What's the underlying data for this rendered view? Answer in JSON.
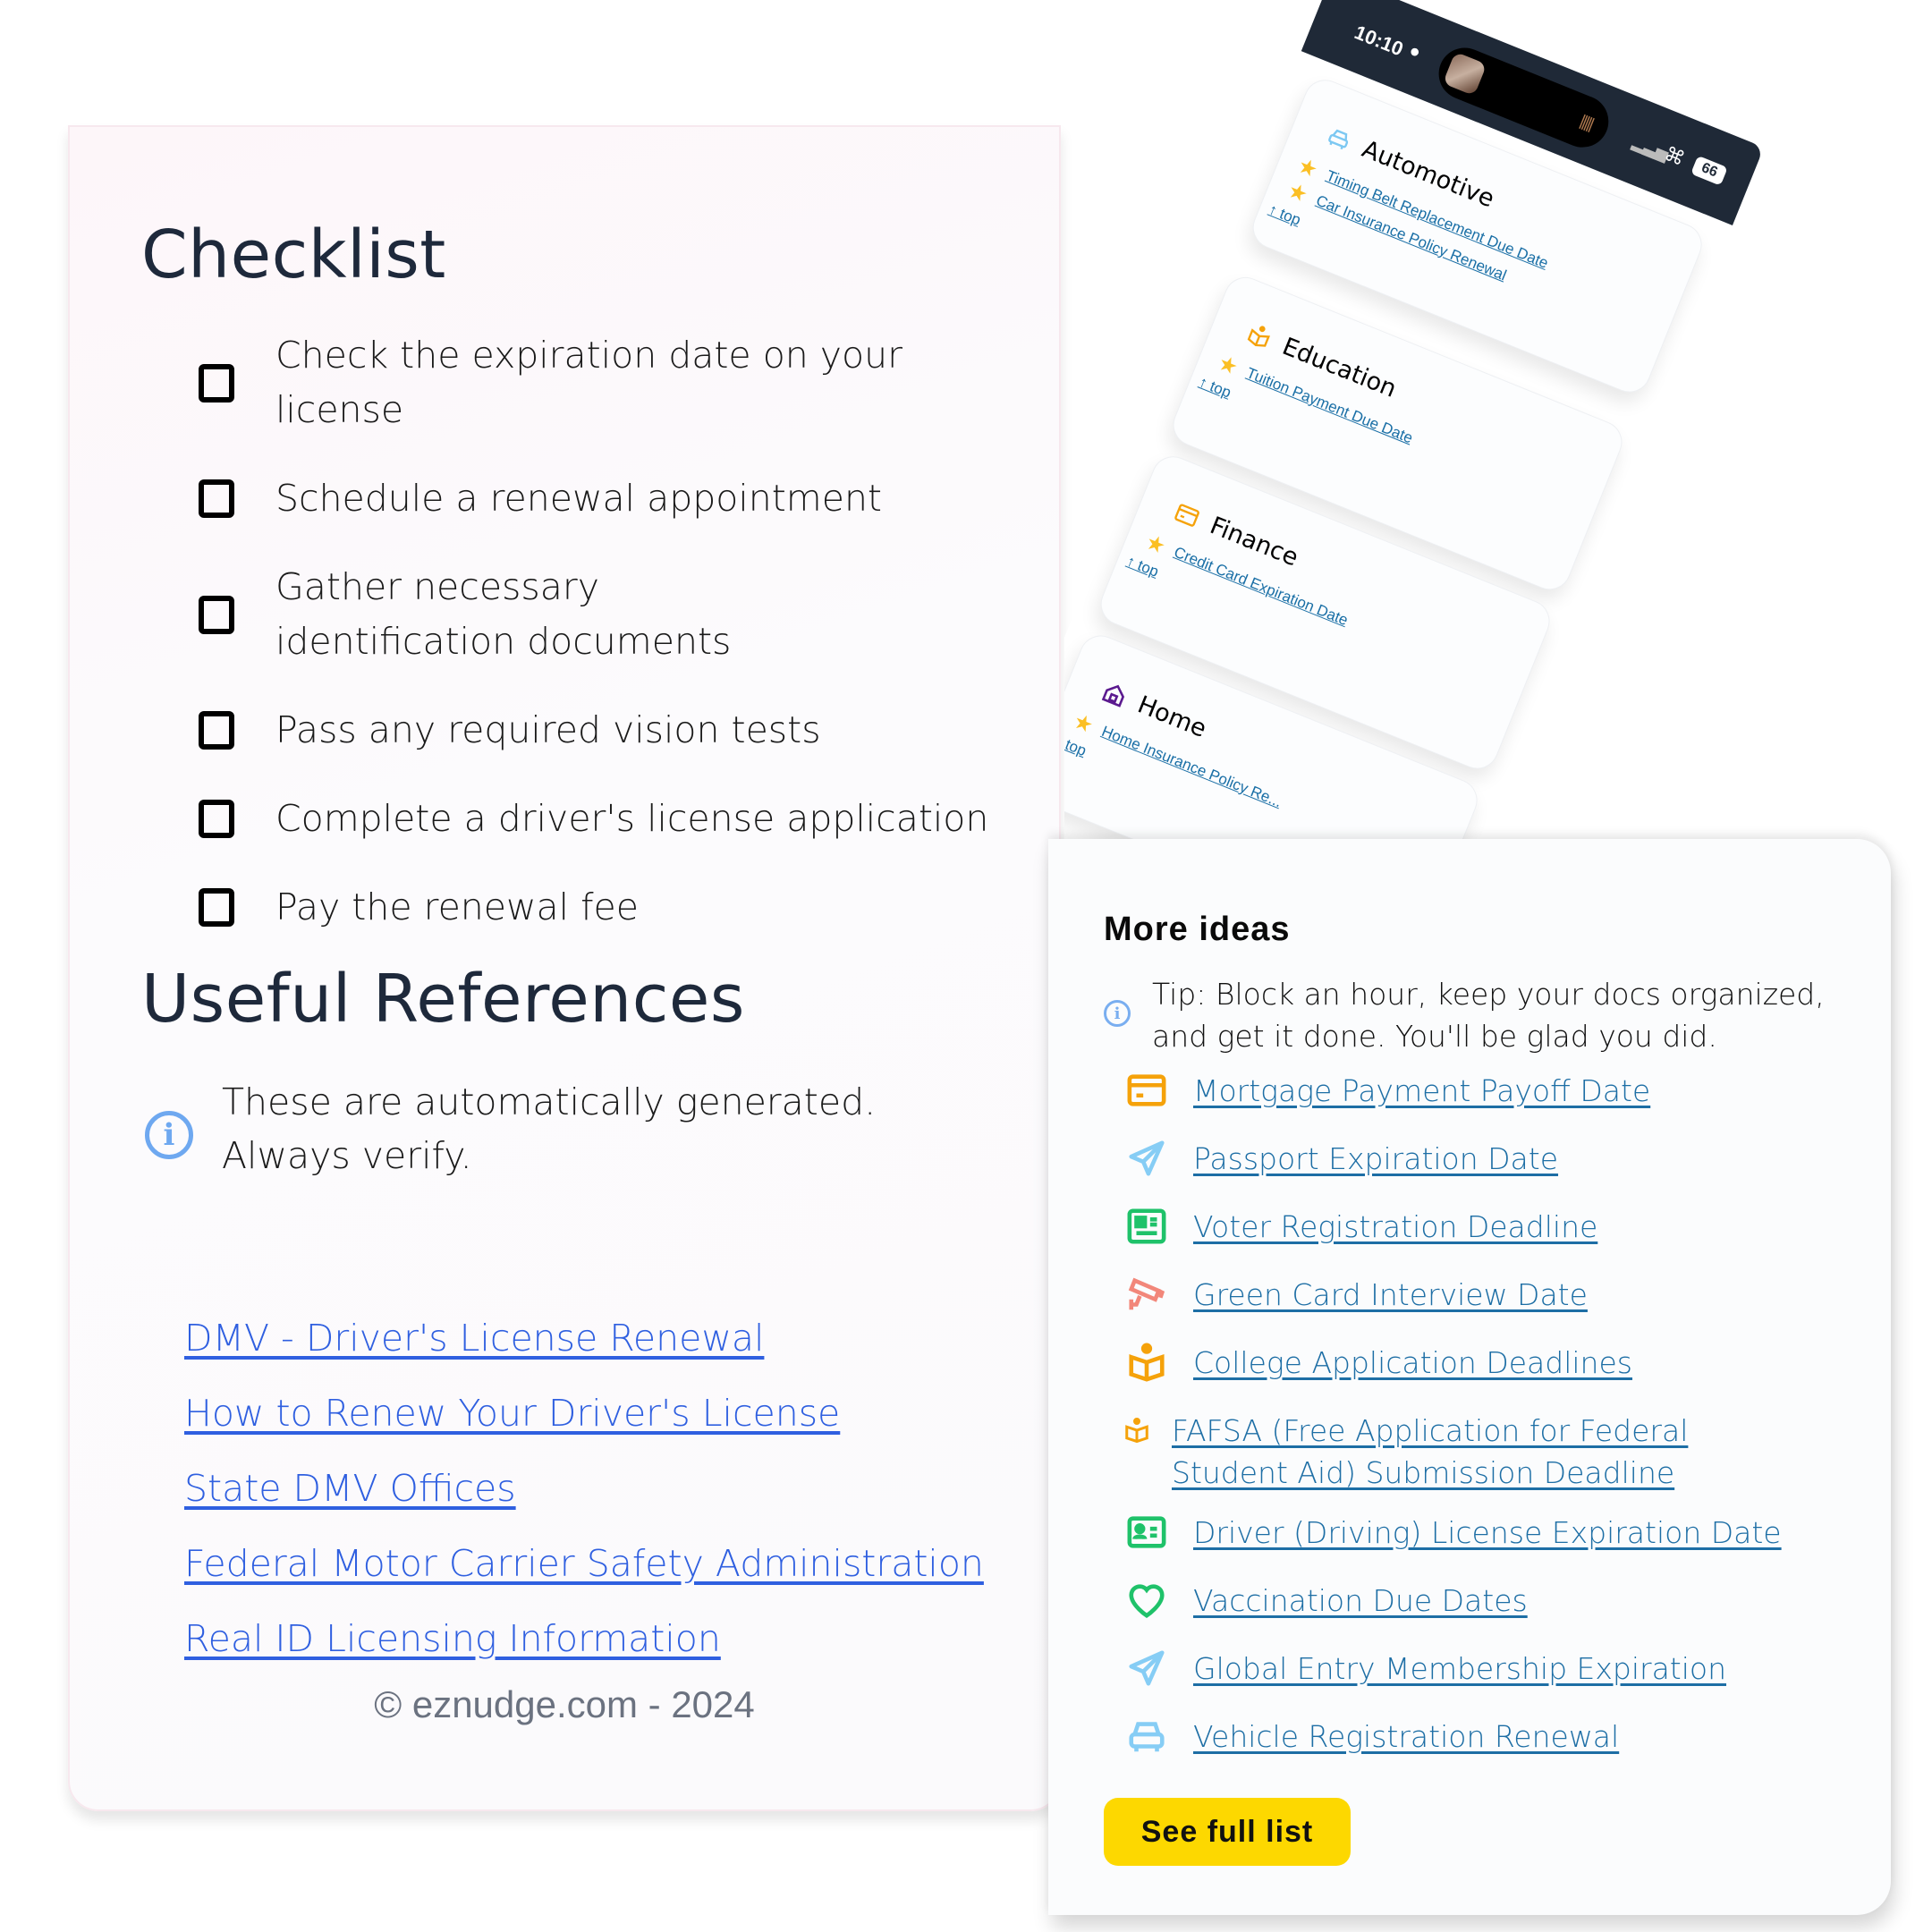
{
  "checklist": {
    "title": "Checklist",
    "items": [
      {
        "label": "Check the expiration date on your license",
        "checked": false
      },
      {
        "label": "Schedule a renewal appointment",
        "checked": false
      },
      {
        "label": "Gather necessary identification documents",
        "checked": false
      },
      {
        "label": "Pass any required vision tests",
        "checked": false
      },
      {
        "label": "Complete a driver's license application",
        "checked": false
      },
      {
        "label": "Pay the renewal fee",
        "checked": false
      }
    ]
  },
  "references": {
    "title": "Useful References",
    "info_icon": "info-circle-icon",
    "info_text": "These are automatically generated. Always verify.",
    "links": [
      "DMV - Driver's License Renewal",
      "How to Renew Your Driver's License",
      "State DMV Offices",
      "Federal Motor Carrier Safety Administration",
      "Real ID Licensing Information"
    ]
  },
  "footer": "© eznudge.com - 2024",
  "phone": {
    "status_bar": {
      "time": "10:10",
      "person_icon": "person-icon",
      "battery": "66"
    },
    "categories": [
      {
        "title": "Automotive",
        "icon": "car-icon",
        "icon_color": "#7cc8f2",
        "links": [
          "Timing Belt Replacement Due Date",
          "Car Insurance Policy Renewal"
        ],
        "top_label": "↑ top"
      },
      {
        "title": "Education",
        "icon": "book-reader-icon",
        "icon_color": "#f5a20a",
        "links": [
          "Tuition Payment Due Date"
        ],
        "top_label": "↑ top"
      },
      {
        "title": "Finance",
        "icon": "credit-card-icon",
        "icon_color": "#f5a20a",
        "links": [
          "Credit Card Expiration Date"
        ],
        "top_label": "↑ top"
      },
      {
        "title": "Home",
        "icon": "house-icon",
        "icon_color": "#5b1a8f",
        "links": [
          "Home Insurance Policy Re..."
        ],
        "top_label": "↑ top"
      }
    ]
  },
  "more_ideas": {
    "title": "More ideas",
    "tip": "Tip: Block an hour, keep your docs organized, and get it done. You'll be glad you did.",
    "items": [
      {
        "label": "Mortgage Payment Payoff Date",
        "icon": "credit-card-icon",
        "color": "#f5a20a"
      },
      {
        "label": "Passport Expiration Date",
        "icon": "paper-plane-icon",
        "color": "#86cdf5"
      },
      {
        "label": "Voter Registration Deadline",
        "icon": "newspaper-icon",
        "color": "#1fc26a"
      },
      {
        "label": "Green Card Interview Date",
        "icon": "security-camera-icon",
        "color": "#f2877a"
      },
      {
        "label": "College Application Deadlines",
        "icon": "book-reader-icon",
        "color": "#f5a20a"
      },
      {
        "label": "FAFSA (Free Application for Federal Student Aid) Submission Deadline",
        "icon": "book-reader-icon",
        "color": "#f5a20a"
      },
      {
        "label": "Driver (Driving) License Expiration Date",
        "icon": "id-card-icon",
        "color": "#1fc26a"
      },
      {
        "label": "Vaccination Due Dates",
        "icon": "heart-icon",
        "color": "#1fc26a"
      },
      {
        "label": "Global Entry Membership Expiration",
        "icon": "paper-plane-icon",
        "color": "#86cdf5"
      },
      {
        "label": "Vehicle Registration Renewal",
        "icon": "car-icon",
        "color": "#86cdf5"
      }
    ],
    "button": "See full list",
    "button_color": "#fdd800"
  },
  "colors": {
    "heading": "#1e293b",
    "ref_link": "#2f5fe0",
    "idea_link": "#1d6ea5",
    "info_icon": "#6ea8f0"
  }
}
